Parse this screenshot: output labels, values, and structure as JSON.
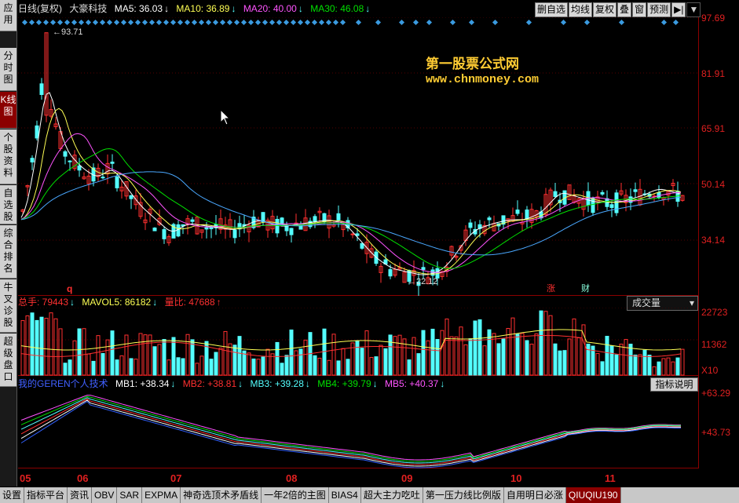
{
  "left_nav": [
    {
      "label": "应用",
      "active": false
    },
    {
      "label": "分时图",
      "active": false
    },
    {
      "label": "K线图",
      "active": true
    },
    {
      "label": "个股资料",
      "active": false
    },
    {
      "label": "自选股",
      "active": false
    },
    {
      "label": "综合排名",
      "active": false
    },
    {
      "label": "牛叉诊股",
      "active": false
    },
    {
      "label": "超级盘口",
      "active": false
    }
  ],
  "main_header": {
    "period": "日线(复权)",
    "stock": "大豪科技",
    "ma5": "MA5: 36.03",
    "ma10": "MA10: 36.89",
    "ma20": "MA20: 40.00",
    "ma30": "MA30: 46.08",
    "arrow": "↓"
  },
  "toolbar": [
    "删自选",
    "均线",
    "复权",
    "叠",
    "窗",
    "预测",
    "▶|",
    "▼"
  ],
  "watermark": {
    "line1": "第一股票公式网",
    "line2": "www.chnmoney.com"
  },
  "main_annotations": {
    "high": "93.71",
    "low": "22.12",
    "q_mark": "q",
    "event1": "涨",
    "event2": "财"
  },
  "price_axis": [
    "97.69",
    "81.91",
    "65.91",
    "50.14",
    "34.14"
  ],
  "vol_header": {
    "total": "总手: 79443",
    "mavol5": "MAVOL5: 86182",
    "ratio": "量比: 47688",
    "down_arrow": "↓",
    "up_arrow": "↑"
  },
  "vol_select": "成交量",
  "vol_axis": [
    "22723",
    "11362",
    "X10"
  ],
  "ind_header": {
    "name": "我的GEREN个人技术",
    "mb1": "MB1: +38.34",
    "mb2": "MB2: +38.81",
    "mb3": "MB3: +39.28",
    "mb4": "MB4: +39.79",
    "mb5": "MB5: +40.37",
    "arrow": "↓"
  },
  "ind_button": "指标说明",
  "ind_axis": [
    "+63.29",
    "+43.73"
  ],
  "x_axis": [
    "05",
    "06",
    "07",
    "08",
    "09",
    "10",
    "11"
  ],
  "bottom_tabs": [
    {
      "label": "设置",
      "active": false
    },
    {
      "label": "指标平台",
      "active": false
    },
    {
      "label": "资讯",
      "active": false
    },
    {
      "label": "OBV",
      "active": false
    },
    {
      "label": "SAR",
      "active": false
    },
    {
      "label": "EXPMA",
      "active": false
    },
    {
      "label": "神奇选顶术矛盾线",
      "active": false
    },
    {
      "label": "一年2倍的主图",
      "active": false
    },
    {
      "label": "BIAS4",
      "active": false
    },
    {
      "label": "超大主力吃吐",
      "active": false
    },
    {
      "label": "第一压力线比例版",
      "active": false
    },
    {
      "label": "自用明日必涨",
      "active": false
    },
    {
      "label": "QIUQIU190",
      "active": true
    }
  ],
  "colors": {
    "up": "#ff3030",
    "down": "#54ffff",
    "ma5": "#ffffff",
    "ma10": "#ffff54",
    "ma20": "#ff54ff",
    "ma30": "#00e000",
    "ma60": "#4aa8ff",
    "axis_red": "#e02020"
  }
}
